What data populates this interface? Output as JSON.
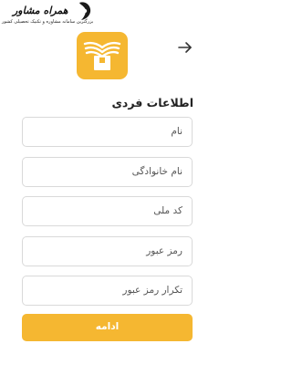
{
  "watermark": {
    "title": "همراه مشاور",
    "subtitle": "بزرگترین سامانه مشاوره و تکنیک تحصیلی کشور"
  },
  "header": {
    "back_icon": "arrow-right-icon"
  },
  "brand": {
    "logo_icon": "open-book-logo-icon",
    "accent_color": "#f5b731"
  },
  "form": {
    "section_title": "اطلاعات فردی",
    "fields": [
      {
        "placeholder": "نام"
      },
      {
        "placeholder": "نام خانوادگی"
      },
      {
        "placeholder": "کد ملی"
      },
      {
        "placeholder": "رمز عبور"
      },
      {
        "placeholder": "تکرار رمز عبور"
      }
    ],
    "submit_label": "ادامه"
  }
}
